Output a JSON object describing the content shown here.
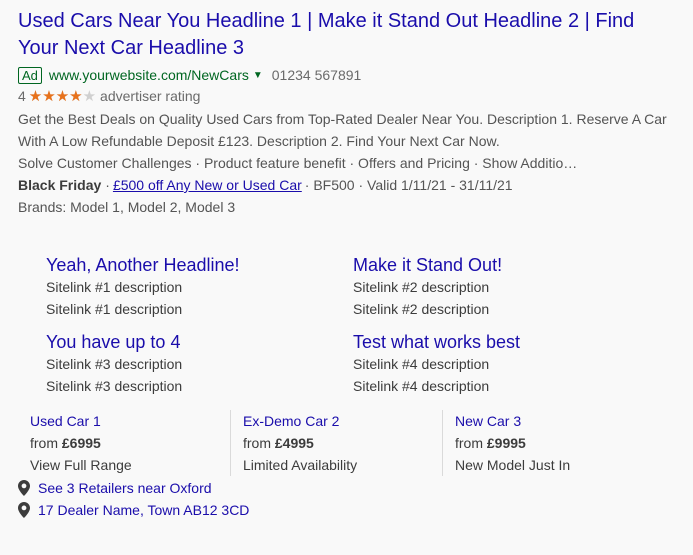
{
  "ad": {
    "headline": "Used Cars Near You Headline 1 | Make it Stand Out Headline 2 | Find Your Next Car Headline 3",
    "badge": "Ad",
    "display_url": "www.yourwebsite.com/NewCars",
    "caret": "▼",
    "phone": "01234 567891",
    "rating": {
      "value_text": "4",
      "stars_filled": 4,
      "stars_total": 5,
      "label": "advertiser rating"
    },
    "description": "Get the Best Deals on Quality Used Cars from Top-Rated Dealer Near You. Description 1. Reserve A Car With A Low Refundable Deposit £123. Description 2. Find Your Next Car Now.",
    "callouts": "Solve Customer Challenges · Product feature benefit · Offers and Pricing · Show Additio…",
    "promotion": {
      "occasion": "Black Friday",
      "sep1": "·",
      "offer": "£500 off Any New or Used Car",
      "rest": "· BF500 · Valid 1/11/21 - 31/11/21"
    },
    "brands": "Brands: Model 1, Model 2, Model 3"
  },
  "sitelinks": [
    {
      "title": "Yeah, Another Headline!",
      "desc1": "Sitelink #1 description",
      "desc2": "Sitelink #1 description"
    },
    {
      "title": "Make it Stand Out!",
      "desc1": "Sitelink #2 description",
      "desc2": "Sitelink #2 description"
    },
    {
      "title": "You have up to 4",
      "desc1": "Sitelink #3 description",
      "desc2": "Sitelink #3 description"
    },
    {
      "title": "Test what works best",
      "desc1": "Sitelink #4 description",
      "desc2": "Sitelink #4 description"
    }
  ],
  "price_cards": [
    {
      "title": "Used Car 1",
      "from": "from",
      "price": "£6995",
      "sub": "View Full Range"
    },
    {
      "title": "Ex-Demo Car 2",
      "from": "from",
      "price": "£4995",
      "sub": "Limited Availability"
    },
    {
      "title": "New Car 3",
      "from": "from",
      "price": "£9995",
      "sub": "New Model Just In"
    }
  ],
  "locations": [
    {
      "text": "See 3 Retailers near Oxford"
    },
    {
      "text": "17 Dealer Name, Town AB12 3CD"
    }
  ],
  "colors": {
    "link": "#1a0dab",
    "url_green": "#006621",
    "star": "#e7711b",
    "text": "#545454"
  },
  "icons": {
    "location": "map-pin-icon"
  }
}
